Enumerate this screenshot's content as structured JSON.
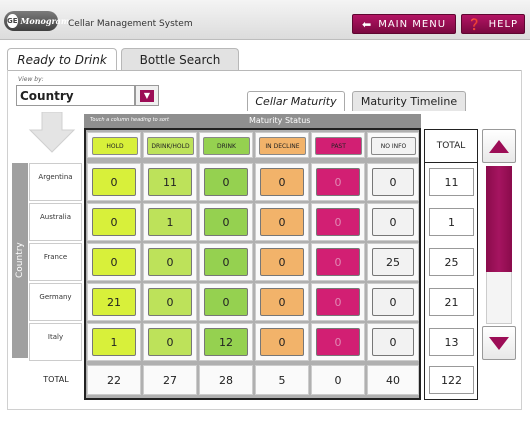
{
  "header": {
    "logo_text": "Monogram",
    "logo_ge": "GE",
    "app_title": "Cellar Management System",
    "main_menu_label": "MAIN MENU",
    "help_label": "HELP"
  },
  "tabs": {
    "ready": "Ready to Drink",
    "bottle": "Bottle Search"
  },
  "view_by": {
    "label": "View by:",
    "value": "Country"
  },
  "subtabs": {
    "cellar": "Cellar Maturity",
    "timeline": "Maturity Timeline"
  },
  "maturity": {
    "hint": "Touch a column heading to sort",
    "title": "Maturity Status",
    "columns": [
      "HOLD",
      "DRINK/HOLD",
      "DRINK",
      "IN DECLINE",
      "PAST",
      "NO INFO"
    ],
    "total_header": "TOTAL"
  },
  "row_group_label": "Country",
  "rows": [
    {
      "label": "Argentina",
      "values": [
        "0",
        "11",
        "0",
        "0",
        "0",
        "0"
      ],
      "total": "11"
    },
    {
      "label": "Australia",
      "values": [
        "0",
        "1",
        "0",
        "0",
        "0",
        "0"
      ],
      "total": "1"
    },
    {
      "label": "France",
      "values": [
        "0",
        "0",
        "0",
        "0",
        "0",
        "25"
      ],
      "total": "25"
    },
    {
      "label": "Germany",
      "values": [
        "21",
        "0",
        "0",
        "0",
        "0",
        "0"
      ],
      "total": "21"
    },
    {
      "label": "Italy",
      "values": [
        "1",
        "0",
        "12",
        "0",
        "0",
        "0"
      ],
      "total": "13"
    }
  ],
  "totals": {
    "label": "TOTAL",
    "values": [
      "22",
      "27",
      "28",
      "5",
      "0",
      "40"
    ],
    "grand": "122"
  },
  "colors": {
    "accent": "#9c0d56",
    "hold": "#d8f03a",
    "drink_hold": "#bde25a",
    "drink": "#95d150",
    "in_decline": "#f2b36a",
    "past": "#d21f73",
    "no_info": "#f2f2f2"
  },
  "icons": {
    "menu": "left-arrow-icon",
    "help": "question-icon",
    "dropdown": "chevron-down-icon",
    "scroll_up": "up-arrow-icon",
    "scroll_down": "down-arrow-icon"
  }
}
